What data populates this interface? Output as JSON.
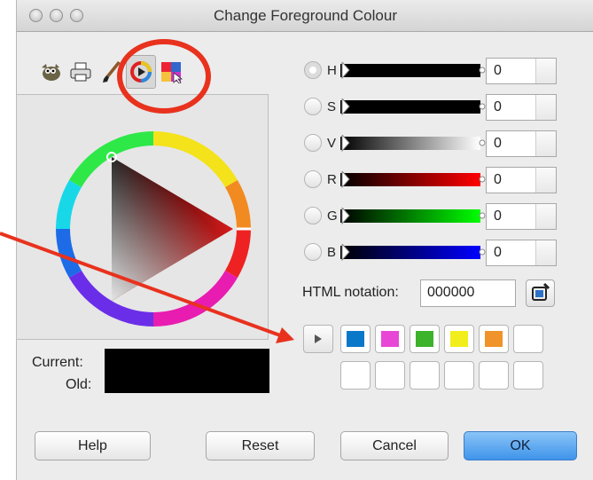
{
  "window": {
    "title": "Change Foreground Colour"
  },
  "tabs": [
    {
      "name": "gimp-selector"
    },
    {
      "name": "cmyk-selector"
    },
    {
      "name": "watercolor-selector"
    },
    {
      "name": "triangle-wheel-selector"
    },
    {
      "name": "palette-selector"
    }
  ],
  "channels": [
    {
      "label": "H",
      "value": "0",
      "selected": true
    },
    {
      "label": "S",
      "value": "0"
    },
    {
      "label": "V",
      "value": "0"
    },
    {
      "label": "R",
      "value": "0"
    },
    {
      "label": "G",
      "value": "0"
    },
    {
      "label": "B",
      "value": "0"
    }
  ],
  "html_notation": {
    "label": "HTML notation:",
    "value": "000000"
  },
  "current_old": {
    "current_label": "Current:",
    "old_label": "Old:"
  },
  "history": {
    "colors_row1": [
      "#0a78c8",
      "#e847d6",
      "#3db22b",
      "#f2ee1c",
      "#f0932a",
      "#ffffff"
    ],
    "colors_row2": [
      "#ffffff",
      "#ffffff",
      "#ffffff",
      "#ffffff",
      "#ffffff",
      "#ffffff"
    ]
  },
  "buttons": {
    "help": "Help",
    "reset": "Reset",
    "cancel": "Cancel",
    "ok": "OK"
  },
  "annotation": {
    "color": "#e8321e"
  }
}
